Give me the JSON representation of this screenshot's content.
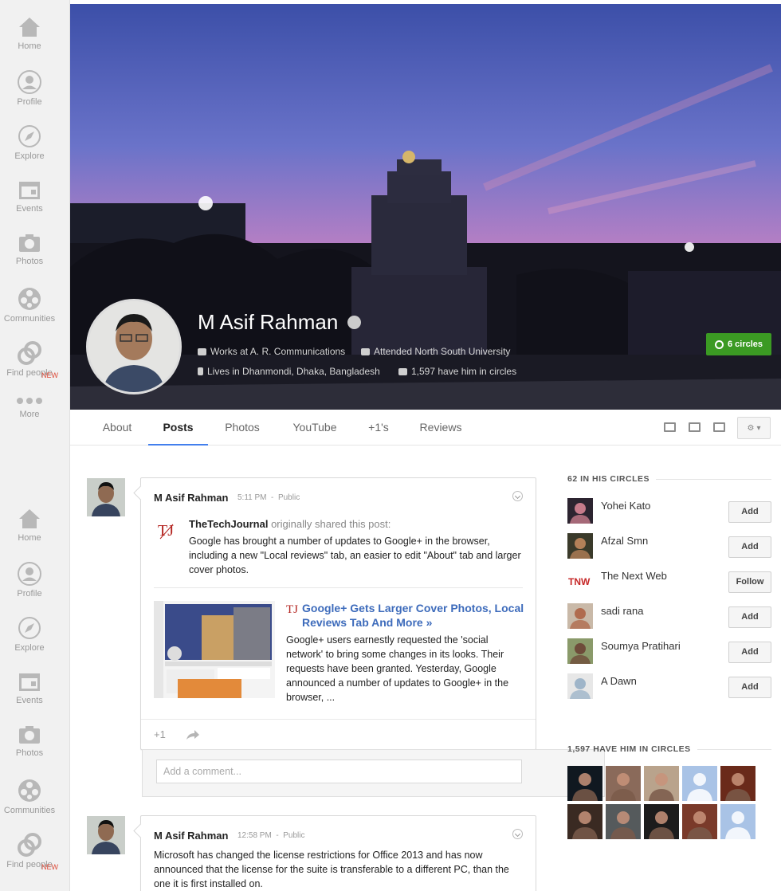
{
  "sidebar": {
    "items": [
      {
        "label": "Home",
        "icon": "home-icon"
      },
      {
        "label": "Profile",
        "icon": "profile-icon"
      },
      {
        "label": "Explore",
        "icon": "compass-icon"
      },
      {
        "label": "Events",
        "icon": "calendar-icon"
      },
      {
        "label": "Photos",
        "icon": "camera-icon"
      },
      {
        "label": "Communities",
        "icon": "communities-icon"
      },
      {
        "label": "Find people",
        "icon": "find-people-icon",
        "badge": "NEW"
      },
      {
        "label": "More",
        "icon": "more-dots-icon"
      }
    ]
  },
  "profile": {
    "name": "M Asif Rahman",
    "work": "Works at A. R. Communications",
    "education": "Attended North South University",
    "location": "Lives in Dhanmondi, Dhaka, Bangladesh",
    "followers": "1,597 have him in circles",
    "circles_button": "6 circles"
  },
  "tabs": {
    "about": "About",
    "posts": "Posts",
    "photos": "Photos",
    "youtube": "YouTube",
    "plus_ones": "+1's",
    "reviews": "Reviews"
  },
  "posts": [
    {
      "author": "M Asif Rahman",
      "time": "5:11 PM",
      "visibility": "Public",
      "shared_from": "TheTechJournal",
      "shared_suffix": " originally shared this post:",
      "text": "Google has brought a number of updates to Google+ in the browser, including a new \"Local reviews\" tab, an easier to edit \"About\" tab and larger cover photos.",
      "link_title": "Google+ Gets Larger Cover Photos, Local Reviews Tab And More »",
      "link_desc": "Google+ users earnestly requested the 'social network' to bring some changes in its looks. Their requests have been granted. Yesterday, Google announced a number of updates to Google+ in the browser, ...",
      "plus_one": "+1",
      "comment_placeholder": "Add a comment..."
    },
    {
      "author": "M Asif Rahman",
      "time": "12:58 PM",
      "visibility": "Public",
      "text": "Microsoft has changed the license restrictions for Office 2013 and has now announced that the license for the suite is transferable to a different PC, than the one it is first installed on."
    }
  ],
  "in_circles": {
    "heading": "62 IN HIS CIRCLES",
    "people": [
      {
        "name": "Yohei Kato",
        "action": "Add"
      },
      {
        "name": "Afzal Smn",
        "action": "Add"
      },
      {
        "name": "The Next Web",
        "action": "Follow"
      },
      {
        "name": "sadi rana",
        "action": "Add"
      },
      {
        "name": "Soumya Pratihari",
        "action": "Add"
      },
      {
        "name": "A Dawn",
        "action": "Add"
      }
    ]
  },
  "have_him": {
    "heading": "1,597 HAVE HIM IN CIRCLES"
  },
  "colors": {
    "accent_blue": "#427fed",
    "circles_green": "#3b9a23",
    "badge_red": "#dd4b39",
    "link_blue": "#3d6bbb"
  }
}
